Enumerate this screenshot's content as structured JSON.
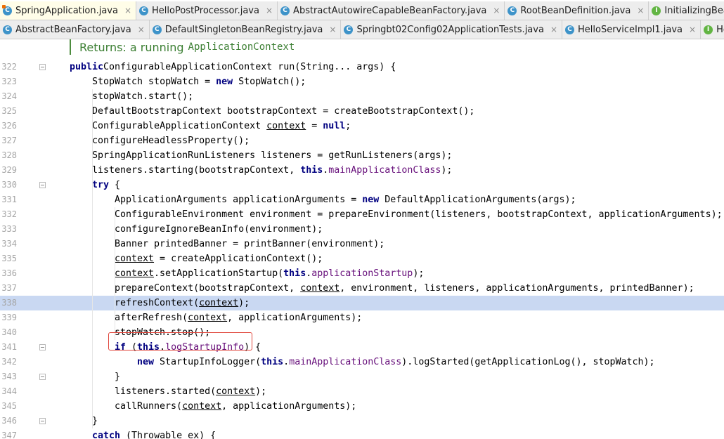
{
  "tabs_row1": [
    {
      "label": "SpringApplication.java",
      "icon": "class-icon",
      "pinned": true,
      "active": true
    },
    {
      "label": "HelloPostProcessor.java",
      "icon": "class-icon"
    },
    {
      "label": "AbstractAutowireCapableBeanFactory.java",
      "icon": "class-icon"
    },
    {
      "label": "RootBeanDefinition.java",
      "icon": "class-icon"
    },
    {
      "label": "InitializingBean.java",
      "icon": "interface-icon"
    },
    {
      "label": "",
      "icon": "class-icon"
    }
  ],
  "tabs_row2": [
    {
      "label": "AbstractBeanFactory.java",
      "icon": "class-icon"
    },
    {
      "label": "DefaultSingletonBeanRegistry.java",
      "icon": "class-icon"
    },
    {
      "label": "Springbt02Config02ApplicationTests.java",
      "icon": "class-icon"
    },
    {
      "label": "HelloServiceImpl1.java",
      "icon": "class-icon"
    },
    {
      "label": "HelloService.java",
      "icon": "interface-icon"
    }
  ],
  "tab_close_glyph": "×",
  "doc_comment": {
    "text": "Returns: a running",
    "code": "ApplicationContext"
  },
  "lines": [
    {
      "n": "322",
      "indent": 0,
      "fold": true,
      "tokens": [
        [
          "kw",
          "public"
        ],
        [
          "",
          "ConfigurableApplicationContext run(String... args) {"
        ]
      ]
    },
    {
      "n": "323",
      "indent": 1,
      "tokens": [
        [
          "",
          "StopWatch stopWatch = "
        ],
        [
          "kw",
          "new"
        ],
        [
          "",
          " StopWatch();"
        ]
      ]
    },
    {
      "n": "324",
      "indent": 1,
      "tokens": [
        [
          "",
          "stopWatch.start();"
        ]
      ]
    },
    {
      "n": "325",
      "indent": 1,
      "tokens": [
        [
          "",
          "DefaultBootstrapContext bootstrapContext = createBootstrapContext();"
        ]
      ]
    },
    {
      "n": "326",
      "indent": 1,
      "tokens": [
        [
          "",
          "ConfigurableApplicationContext "
        ],
        [
          "u",
          "context"
        ],
        [
          "",
          " = "
        ],
        [
          "kw",
          "null"
        ],
        [
          "",
          ";"
        ]
      ]
    },
    {
      "n": "327",
      "indent": 1,
      "tokens": [
        [
          "",
          "configureHeadlessProperty();"
        ]
      ]
    },
    {
      "n": "328",
      "indent": 1,
      "tokens": [
        [
          "",
          "SpringApplicationRunListeners listeners = getRunListeners(args);"
        ]
      ]
    },
    {
      "n": "329",
      "indent": 1,
      "tokens": [
        [
          "",
          "listeners.starting(bootstrapContext, "
        ],
        [
          "kw",
          "this"
        ],
        [
          "",
          "."
        ],
        [
          "f",
          "mainApplicationClass"
        ],
        [
          "",
          ");"
        ]
      ]
    },
    {
      "n": "330",
      "indent": 1,
      "fold": true,
      "tokens": [
        [
          "kw",
          "try"
        ],
        [
          "",
          " {"
        ]
      ]
    },
    {
      "n": "331",
      "indent": 2,
      "tokens": [
        [
          "",
          "ApplicationArguments applicationArguments = "
        ],
        [
          "kw",
          "new"
        ],
        [
          "",
          " DefaultApplicationArguments(args);"
        ]
      ]
    },
    {
      "n": "332",
      "indent": 2,
      "tokens": [
        [
          "",
          "ConfigurableEnvironment environment = prepareEnvironment(listeners, bootstrapContext, applicationArguments);"
        ]
      ]
    },
    {
      "n": "333",
      "indent": 2,
      "tokens": [
        [
          "",
          "configureIgnoreBeanInfo(environment);"
        ]
      ]
    },
    {
      "n": "334",
      "indent": 2,
      "tokens": [
        [
          "",
          "Banner printedBanner = printBanner(environment);"
        ]
      ]
    },
    {
      "n": "335",
      "indent": 2,
      "tokens": [
        [
          "u",
          "context"
        ],
        [
          "",
          " = createApplicationContext();"
        ]
      ]
    },
    {
      "n": "336",
      "indent": 2,
      "tokens": [
        [
          "u",
          "context"
        ],
        [
          "",
          ".setApplicationStartup("
        ],
        [
          "kw",
          "this"
        ],
        [
          "",
          "."
        ],
        [
          "f",
          "applicationStartup"
        ],
        [
          "",
          ");"
        ]
      ]
    },
    {
      "n": "337",
      "indent": 2,
      "tokens": [
        [
          "",
          "prepareContext(bootstrapContext, "
        ],
        [
          "u",
          "context"
        ],
        [
          "",
          ", environment, listeners, applicationArguments, printedBanner);"
        ]
      ]
    },
    {
      "n": "338",
      "indent": 2,
      "current": true,
      "tokens": [
        [
          "",
          "refreshContext("
        ],
        [
          "u",
          "context"
        ],
        [
          "",
          ");"
        ]
      ]
    },
    {
      "n": "339",
      "indent": 2,
      "tokens": [
        [
          "",
          "afterRefresh("
        ],
        [
          "u",
          "context"
        ],
        [
          "",
          ", applicationArguments);"
        ]
      ]
    },
    {
      "n": "340",
      "indent": 2,
      "tokens": [
        [
          "",
          "stopWatch.stop();"
        ]
      ]
    },
    {
      "n": "341",
      "indent": 2,
      "fold": true,
      "tokens": [
        [
          "kw",
          "if"
        ],
        [
          "",
          " ("
        ],
        [
          "kw",
          "this"
        ],
        [
          "",
          "."
        ],
        [
          "f",
          "logStartupInfo"
        ],
        [
          "",
          ") {"
        ]
      ]
    },
    {
      "n": "342",
      "indent": 3,
      "tokens": [
        [
          "kw",
          "new"
        ],
        [
          "",
          " StartupInfoLogger("
        ],
        [
          "kw",
          "this"
        ],
        [
          "",
          "."
        ],
        [
          "f",
          "mainApplicationClass"
        ],
        [
          "",
          ").logStarted(getApplicationLog(), stopWatch);"
        ]
      ]
    },
    {
      "n": "343",
      "indent": 2,
      "fold": true,
      "tokens": [
        [
          "",
          "}"
        ]
      ]
    },
    {
      "n": "344",
      "indent": 2,
      "tokens": [
        [
          "",
          "listeners.started("
        ],
        [
          "u",
          "context"
        ],
        [
          "",
          ");"
        ]
      ]
    },
    {
      "n": "345",
      "indent": 2,
      "tokens": [
        [
          "",
          "callRunners("
        ],
        [
          "u",
          "context"
        ],
        [
          "",
          ", applicationArguments);"
        ]
      ]
    },
    {
      "n": "346",
      "indent": 1,
      "fold": true,
      "tokens": [
        [
          "",
          "}"
        ]
      ]
    },
    {
      "n": "347",
      "indent": 1,
      "tokens": [
        [
          "kw",
          "catch"
        ],
        [
          "",
          " (Throwable ex) {"
        ]
      ]
    }
  ],
  "colors": {
    "keyword": "#000080",
    "field": "#660e7a",
    "current_line": "#c9d8f2",
    "highlight_box": "#e0463c"
  }
}
